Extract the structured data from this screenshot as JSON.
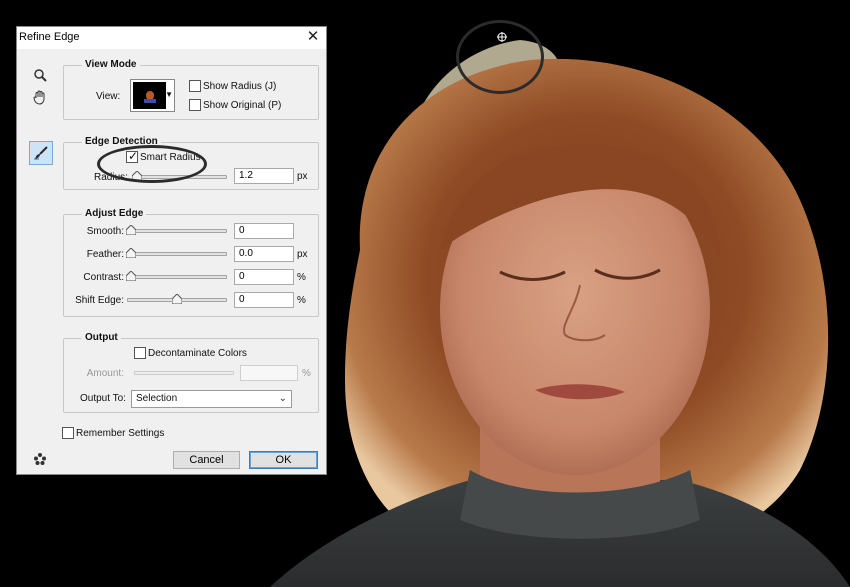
{
  "dialog": {
    "title": "Refine Edge",
    "close_glyph": "✕",
    "view_mode": {
      "legend": "View Mode",
      "view_label": "View:",
      "show_radius": {
        "label": "Show Radius (J)",
        "checked": false
      },
      "show_original": {
        "label": "Show Original (P)",
        "checked": false
      }
    },
    "edge_detection": {
      "legend": "Edge Detection",
      "smart_radius": {
        "label": "Smart Radius",
        "checked": true
      },
      "radius_label": "Radius:",
      "radius_value": "1.2",
      "radius_unit": "px"
    },
    "adjust_edge": {
      "legend": "Adjust Edge",
      "smooth": {
        "label": "Smooth:",
        "value": "0"
      },
      "feather": {
        "label": "Feather:",
        "value": "0.0",
        "unit": "px"
      },
      "contrast": {
        "label": "Contrast:",
        "value": "0",
        "unit": "%"
      },
      "shift_edge": {
        "label": "Shift Edge:",
        "value": "0",
        "unit": "%"
      }
    },
    "output": {
      "legend": "Output",
      "decontaminate": {
        "label": "Decontaminate Colors",
        "checked": false
      },
      "amount_label": "Amount:",
      "amount_value": "",
      "amount_unit": "%",
      "output_to_label": "Output To:",
      "output_to_value": "Selection"
    },
    "remember_settings": {
      "label": "Remember Settings",
      "checked": false
    },
    "cancel_label": "Cancel",
    "ok_label": "OK"
  },
  "icons": {
    "zoom": "zoom-icon",
    "hand": "hand-icon",
    "refine_radius_brush": "refine-radius-brush-icon",
    "settings": "settings-icon",
    "dropdown_arrow": "chevron-down-icon"
  },
  "colors": {
    "dialog_bg": "#f0f0f0",
    "accent_blue": "#3c7fb1",
    "background": "#000000"
  }
}
